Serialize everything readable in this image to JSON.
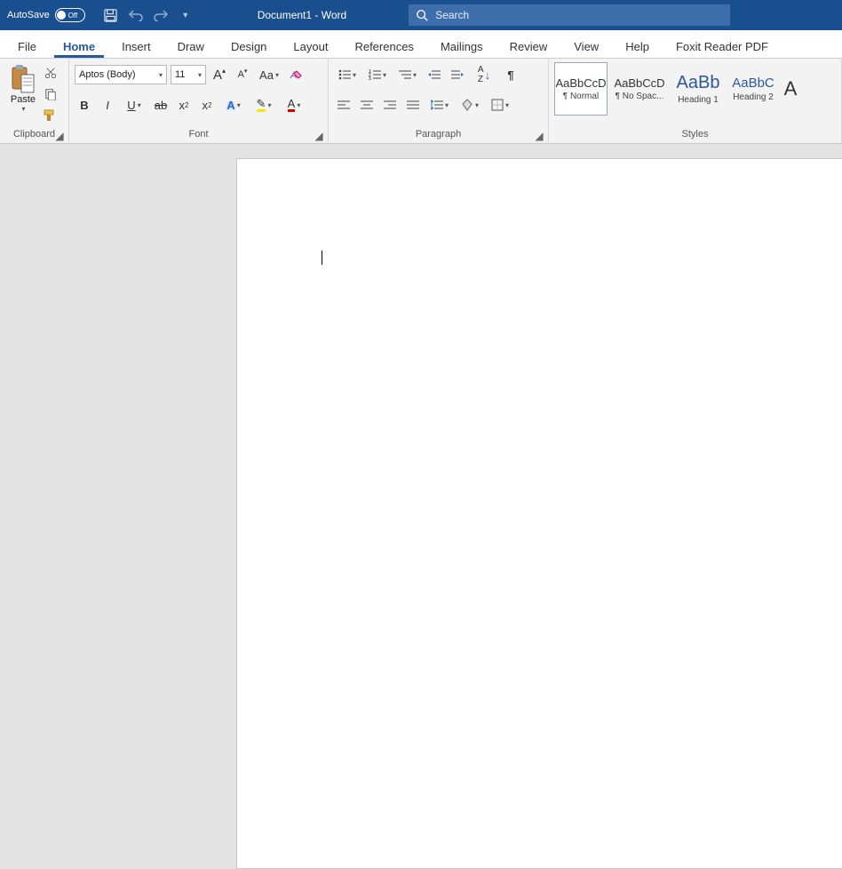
{
  "titlebar": {
    "autosave_label": "AutoSave",
    "autosave_state": "Off",
    "document_title": "Document1  -  Word",
    "search_placeholder": "Search"
  },
  "tabs": [
    {
      "id": "file",
      "label": "File"
    },
    {
      "id": "home",
      "label": "Home",
      "active": true
    },
    {
      "id": "insert",
      "label": "Insert"
    },
    {
      "id": "draw",
      "label": "Draw"
    },
    {
      "id": "design",
      "label": "Design"
    },
    {
      "id": "layout",
      "label": "Layout"
    },
    {
      "id": "references",
      "label": "References"
    },
    {
      "id": "mailings",
      "label": "Mailings"
    },
    {
      "id": "review",
      "label": "Review"
    },
    {
      "id": "view",
      "label": "View"
    },
    {
      "id": "help",
      "label": "Help"
    },
    {
      "id": "foxit",
      "label": "Foxit Reader PDF"
    }
  ],
  "ribbon": {
    "clipboard": {
      "label": "Clipboard",
      "paste": "Paste"
    },
    "font": {
      "label": "Font",
      "name": "Aptos (Body)",
      "size": "11",
      "change_case": "Aa"
    },
    "paragraph": {
      "label": "Paragraph"
    },
    "styles": {
      "label": "Styles",
      "items": [
        {
          "sample": "AaBbCcD",
          "name": "¶ Normal",
          "selected": true,
          "cls": ""
        },
        {
          "sample": "AaBbCcD",
          "name": "¶ No Spac...",
          "cls": ""
        },
        {
          "sample": "AaBb",
          "name": "Heading 1",
          "cls": "h1"
        },
        {
          "sample": "AaBbC",
          "name": "Heading 2",
          "cls": "h2"
        }
      ]
    }
  }
}
